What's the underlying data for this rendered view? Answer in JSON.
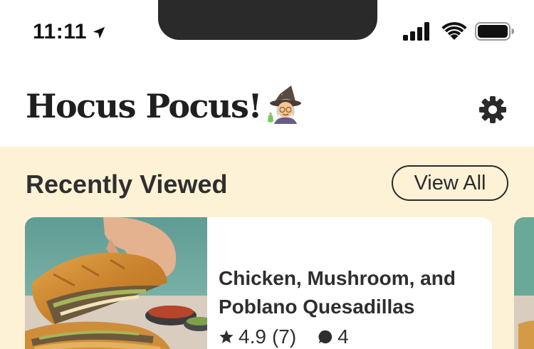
{
  "status_bar": {
    "time": "11:11",
    "icons": [
      "location-arrow-icon",
      "cellular-signal-icon",
      "wifi-icon",
      "battery-icon"
    ]
  },
  "header": {
    "title": "Hocus Pocus!",
    "title_emoji_icon": "wizard-icon",
    "settings_icon": "gear-icon"
  },
  "recently_viewed": {
    "heading": "Recently Viewed",
    "view_all_label": "View All",
    "cards": [
      {
        "title": "Chicken, Mushroom, and Poblano Quesadillas",
        "rating": "4.9",
        "rating_count": "(7)",
        "comments": "4",
        "image_icon": "quesadilla-photo"
      }
    ]
  },
  "colors": {
    "content_background": "#fdf2d5",
    "text": "#2b2b2b",
    "card_background": "#ffffff",
    "notch": "#2a2a2a"
  }
}
